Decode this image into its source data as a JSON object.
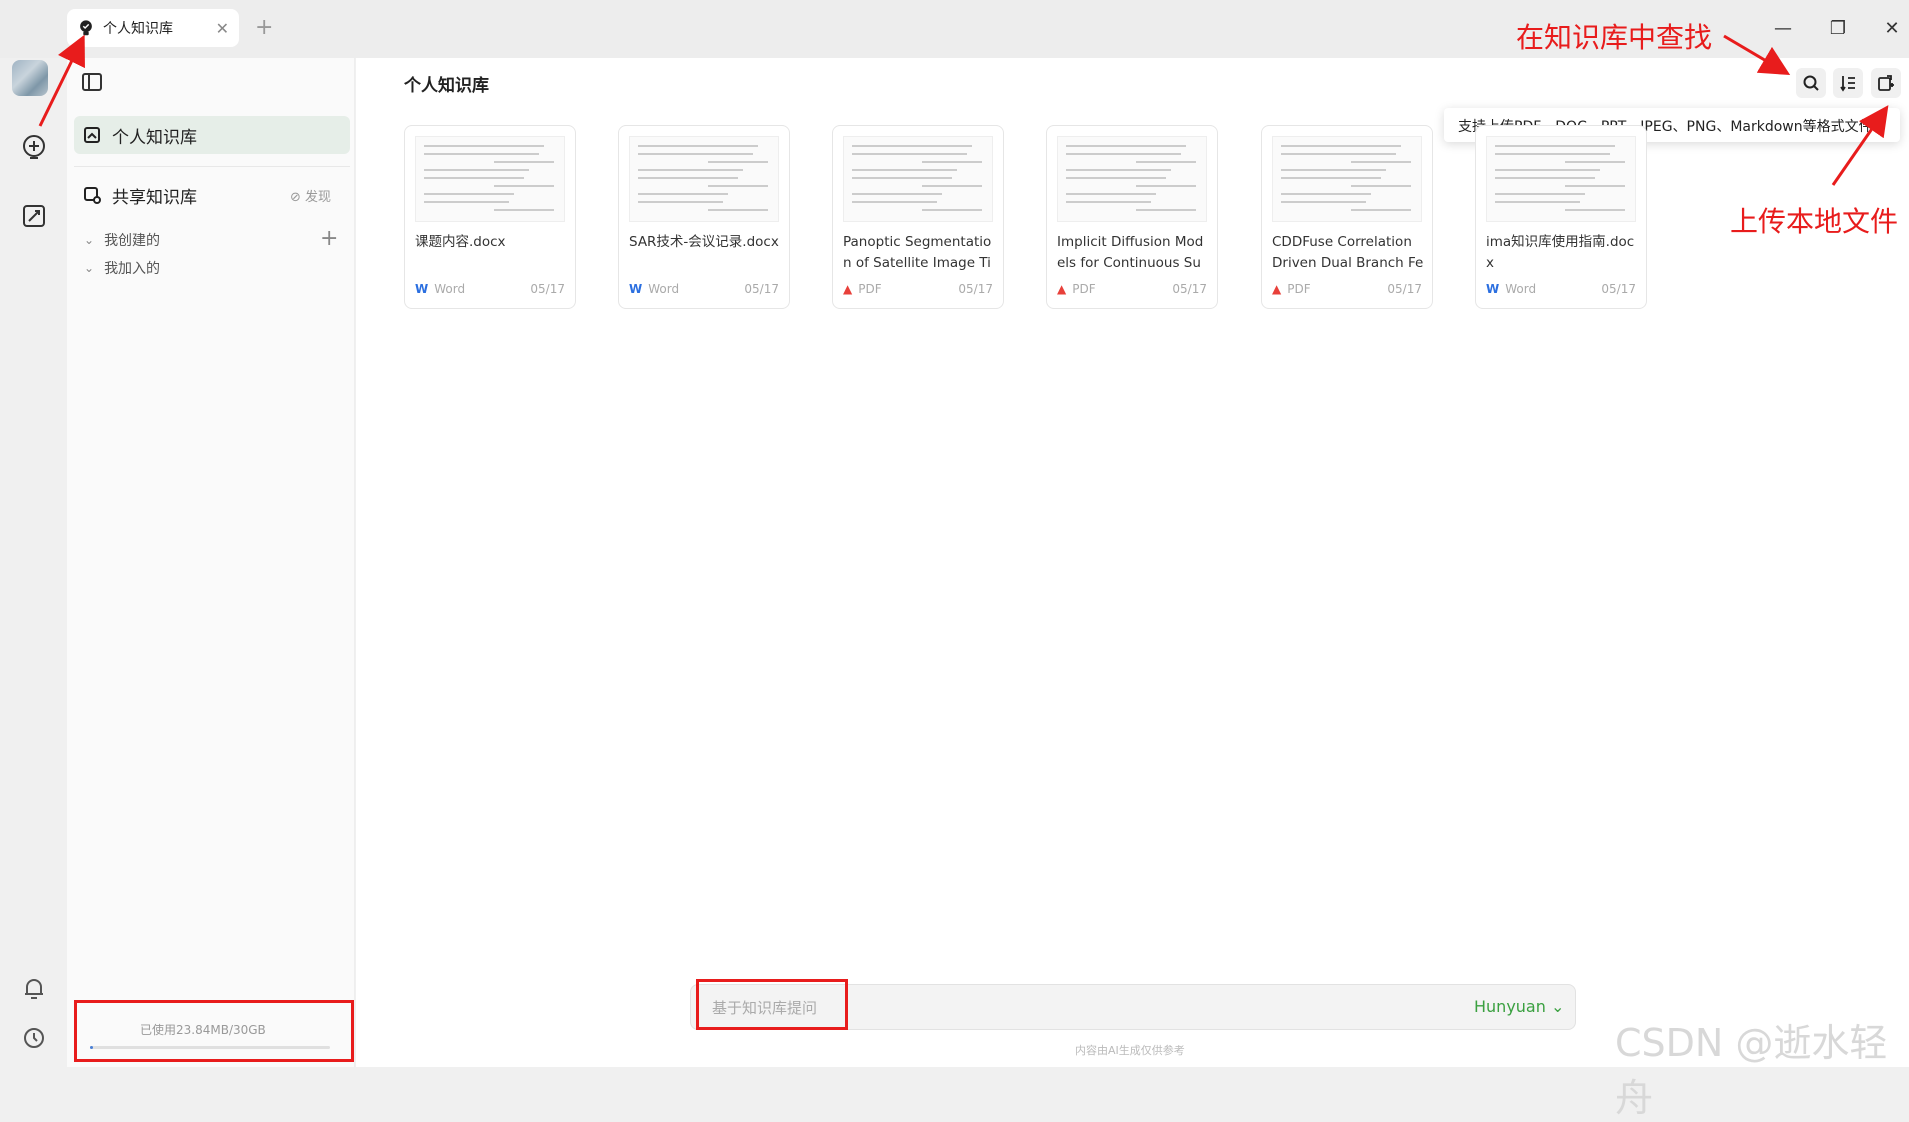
{
  "tab": {
    "title": "个人知识库",
    "close": "✕",
    "new": "+"
  },
  "window": {
    "minimize": "—",
    "restore": "❐",
    "close": "✕"
  },
  "sidebar": {
    "personal": "个人知识库",
    "shared": "共享知识库",
    "discover": "⊘ 发现",
    "created": "我创建的",
    "joined": "我加入的",
    "add": "+",
    "usage": "已使用23.84MB/30GB",
    "usage_fraction": 0.0008
  },
  "main": {
    "title": "个人知识库",
    "tooltip": "支持上传PDF、DOC、PPT、JPEG、PNG、Markdown等格式文件"
  },
  "files": [
    {
      "name": "课题内容.docx",
      "type": "Word",
      "date": "05/17",
      "icon": "word-icon",
      "color": "#2b6fe0"
    },
    {
      "name": "SAR技术-会议记录.docx",
      "type": "Word",
      "date": "05/17",
      "icon": "word-icon",
      "color": "#2b6fe0"
    },
    {
      "name": "Panoptic Segmentation of Satellite Image Tim...",
      "type": "PDF",
      "date": "05/17",
      "icon": "pdf-icon",
      "color": "#e8403a"
    },
    {
      "name": "Implicit Diffusion Models for Continuous Sup...",
      "type": "PDF",
      "date": "05/17",
      "icon": "pdf-icon",
      "color": "#e8403a"
    },
    {
      "name": "CDDFuse Correlation Driven Dual Branch Feat...",
      "type": "PDF",
      "date": "05/17",
      "icon": "pdf-icon",
      "color": "#e8403a"
    },
    {
      "name": "ima知识库使用指南.docx",
      "type": "Word",
      "date": "05/17",
      "icon": "word-icon",
      "color": "#2b6fe0"
    }
  ],
  "ask": {
    "placeholder": "基于知识库提问",
    "model": "Hunyuan ⌄",
    "disclaimer": "内容由AI生成仅供参考"
  },
  "annotations": {
    "search": "在知识库中查找",
    "upload": "上传本地文件"
  },
  "watermark": "CSDN @逝水轻舟"
}
